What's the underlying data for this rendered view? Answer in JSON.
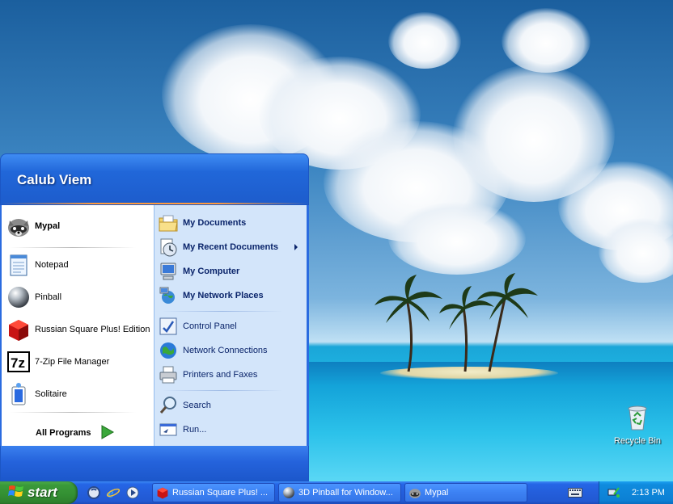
{
  "desktop": {
    "recycle_bin_label": "Recycle Bin",
    "recycle_bin_icon": "recycle-bin-icon"
  },
  "start_menu": {
    "user_name": "Calub Viem",
    "pinned": [
      {
        "label": "Mypal",
        "icon": "raccoon-icon"
      }
    ],
    "recent_programs": [
      {
        "label": "Notepad",
        "icon": "notepad-icon"
      },
      {
        "label": "Pinball",
        "icon": "pinball-icon"
      },
      {
        "label": "Russian Square Plus! Edition",
        "icon": "red-cube-icon"
      },
      {
        "label": "7-Zip File Manager",
        "icon": "7zip-icon"
      },
      {
        "label": "Solitaire",
        "icon": "solitaire-icon"
      }
    ],
    "all_programs_label": "All Programs",
    "places": [
      {
        "label": "My Documents",
        "icon": "folder-documents-icon"
      },
      {
        "label": "My Recent Documents",
        "icon": "recent-documents-icon"
      },
      {
        "label": "My Computer",
        "icon": "computer-icon"
      },
      {
        "label": "My Network Places",
        "icon": "network-places-icon"
      }
    ],
    "system": [
      {
        "label": "Control Panel",
        "icon": "control-panel-icon"
      },
      {
        "label": "Network Connections",
        "icon": "network-connections-icon"
      },
      {
        "label": "Printers and Faxes",
        "icon": "printer-icon"
      }
    ],
    "tools": [
      {
        "label": "Search",
        "icon": "search-icon"
      },
      {
        "label": "Run...",
        "icon": "run-icon"
      }
    ]
  },
  "taskbar": {
    "start_label": "start",
    "quick_launch": [
      "ie-settings-icon",
      "internet-explorer-icon",
      "media-player-icon"
    ],
    "tasks": [
      {
        "label": "Russian Square Plus! ...",
        "icon": "red-cube-icon"
      },
      {
        "label": "3D Pinball for Window...",
        "icon": "pinball-icon"
      },
      {
        "label": "Mypal",
        "icon": "raccoon-icon"
      }
    ],
    "clock": "2:13 PM"
  },
  "colors": {
    "taskbar_blue": "#245edb",
    "start_green": "#338f32",
    "menu_header_blue": "#2167d9",
    "menu_right_panel": "#d3e5fa",
    "tray_blue": "#0c80d4"
  }
}
